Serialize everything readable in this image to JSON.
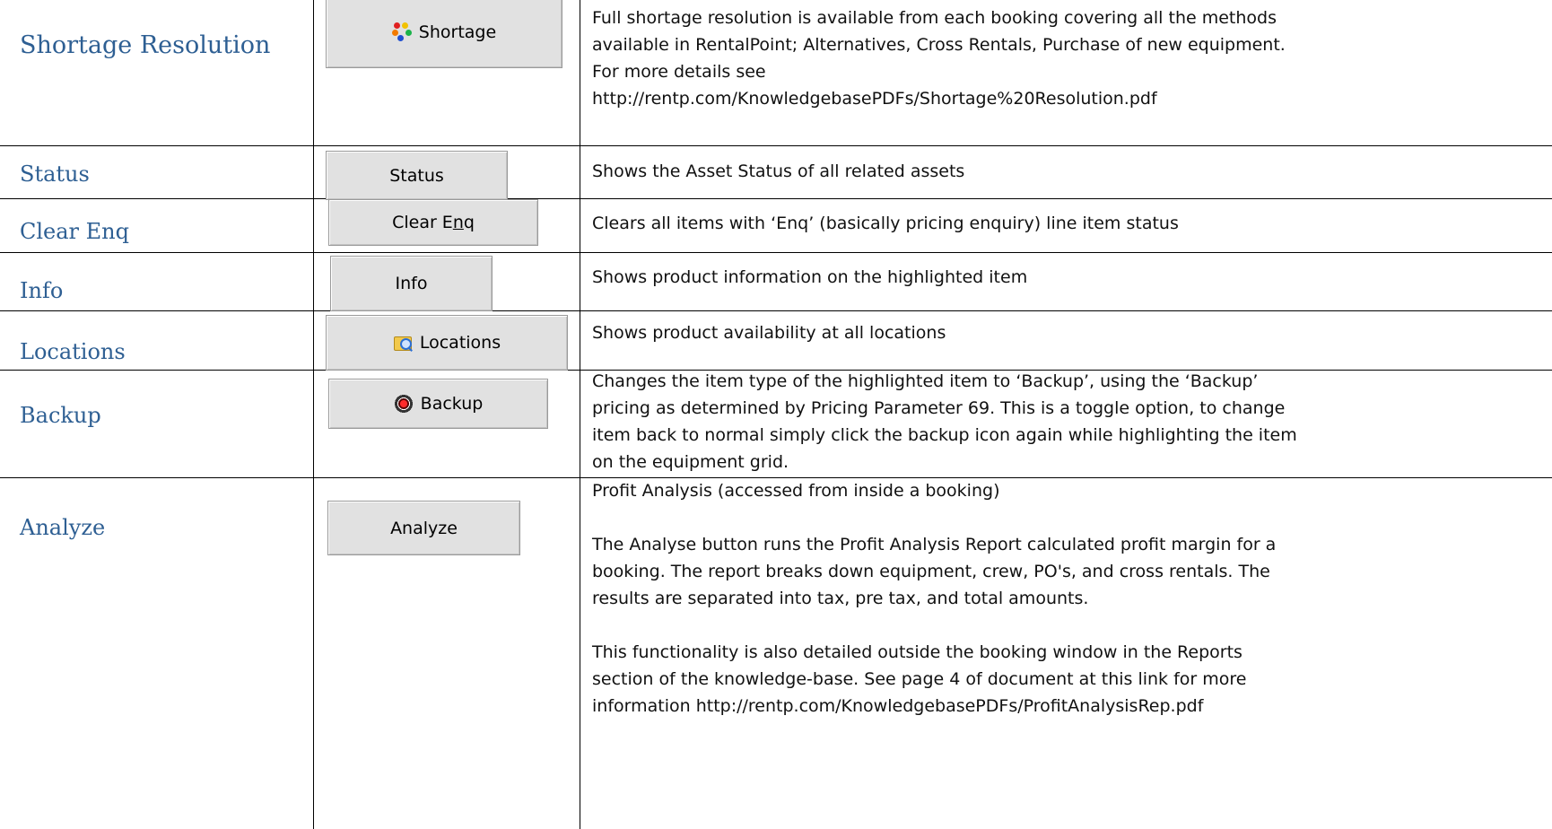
{
  "rows": [
    {
      "term": "Shortage Resolution",
      "button_label": "Shortage",
      "button_icon": "shortage-icon",
      "description": [
        "Full shortage resolution is available from each booking covering all the methods",
        "available in RentalPoint; Alternatives, Cross Rentals, Purchase of new equipment.",
        "For more details see",
        "http://rentp.com/KnowledgebasePDFs/Shortage%20Resolution.pdf"
      ]
    },
    {
      "term": "Status",
      "button_label": "Status",
      "description": [
        "Shows the Asset Status of all related assets"
      ]
    },
    {
      "term": "Clear Enq",
      "button_label_pre": "Clear E",
      "button_label_u": "n",
      "button_label_post": "q",
      "description": [
        "Clears all items with ‘Enq’ (basically pricing enquiry) line item status"
      ]
    },
    {
      "term": "Info",
      "button_label": "Info",
      "description": [
        "Shows product information on the highlighted item"
      ]
    },
    {
      "term": "Locations",
      "button_label": "Locations",
      "button_icon": "locations-icon",
      "description": [
        "Shows product availability at all locations"
      ]
    },
    {
      "term": "Backup",
      "button_label": "Backup",
      "button_icon": "backup-icon",
      "description": [
        "Changes the item type of the highlighted item to ‘Backup’, using the ‘Backup’",
        "pricing as determined by Pricing Parameter 69.  This is a toggle option, to change",
        "item back to normal simply click the backup icon again while highlighting the item",
        "on the equipment grid."
      ]
    },
    {
      "term": "Analyze",
      "button_label": "Analyze",
      "description": [
        "Profit Analysis (accessed from inside a booking)",
        "",
        "The Analyse button runs the Profit Analysis Report calculated profit margin for a",
        "booking. The report breaks down equipment, crew, PO's, and cross rentals. The",
        "results are separated into tax, pre tax, and total amounts.",
        "",
        "This functionality is also detailed outside the booking window in the Reports",
        "section of the knowledge-base.   See page 4 of document at this link for more",
        "information http://rentp.com/KnowledgebasePDFs/ProfitAnalysisRep.pdf"
      ]
    }
  ],
  "colors": {
    "term_text": "#2E5F93",
    "button_face": "#E1E1E1",
    "rule": "#000000"
  }
}
